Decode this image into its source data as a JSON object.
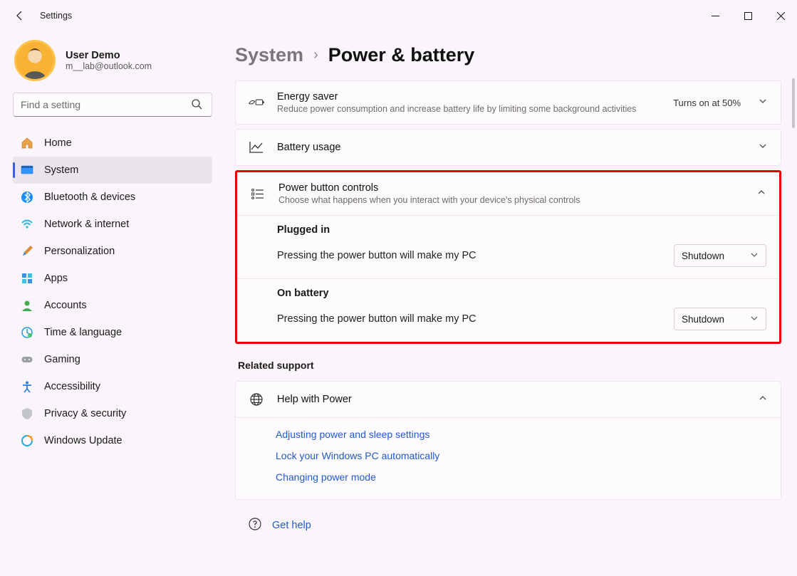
{
  "app": {
    "title": "Settings"
  },
  "user": {
    "name": "User Demo",
    "email": "m__lab@outlook.com"
  },
  "search": {
    "placeholder": "Find a setting"
  },
  "nav": [
    {
      "label": "Home"
    },
    {
      "label": "System"
    },
    {
      "label": "Bluetooth & devices"
    },
    {
      "label": "Network & internet"
    },
    {
      "label": "Personalization"
    },
    {
      "label": "Apps"
    },
    {
      "label": "Accounts"
    },
    {
      "label": "Time & language"
    },
    {
      "label": "Gaming"
    },
    {
      "label": "Accessibility"
    },
    {
      "label": "Privacy & security"
    },
    {
      "label": "Windows Update"
    }
  ],
  "breadcrumb": {
    "parent": "System",
    "current": "Power & battery"
  },
  "cards": {
    "energy": {
      "title": "Energy saver",
      "subtitle": "Reduce power consumption and increase battery life by limiting some background activities",
      "status": "Turns on at 50%"
    },
    "battery_usage": {
      "title": "Battery usage"
    },
    "power_button": {
      "title": "Power button controls",
      "subtitle": "Choose what happens when you interact with your device's physical controls",
      "plugged_header": "Plugged in",
      "plugged_label": "Pressing the power button will make my PC",
      "plugged_value": "Shutdown",
      "battery_header": "On battery",
      "battery_label": "Pressing the power button will make my PC",
      "battery_value": "Shutdown"
    },
    "related": {
      "header": "Related support"
    },
    "help": {
      "title": "Help with Power",
      "links": [
        "Adjusting power and sleep settings",
        "Lock your Windows PC automatically",
        "Changing power mode"
      ]
    },
    "gethelp": {
      "label": "Get help"
    }
  }
}
